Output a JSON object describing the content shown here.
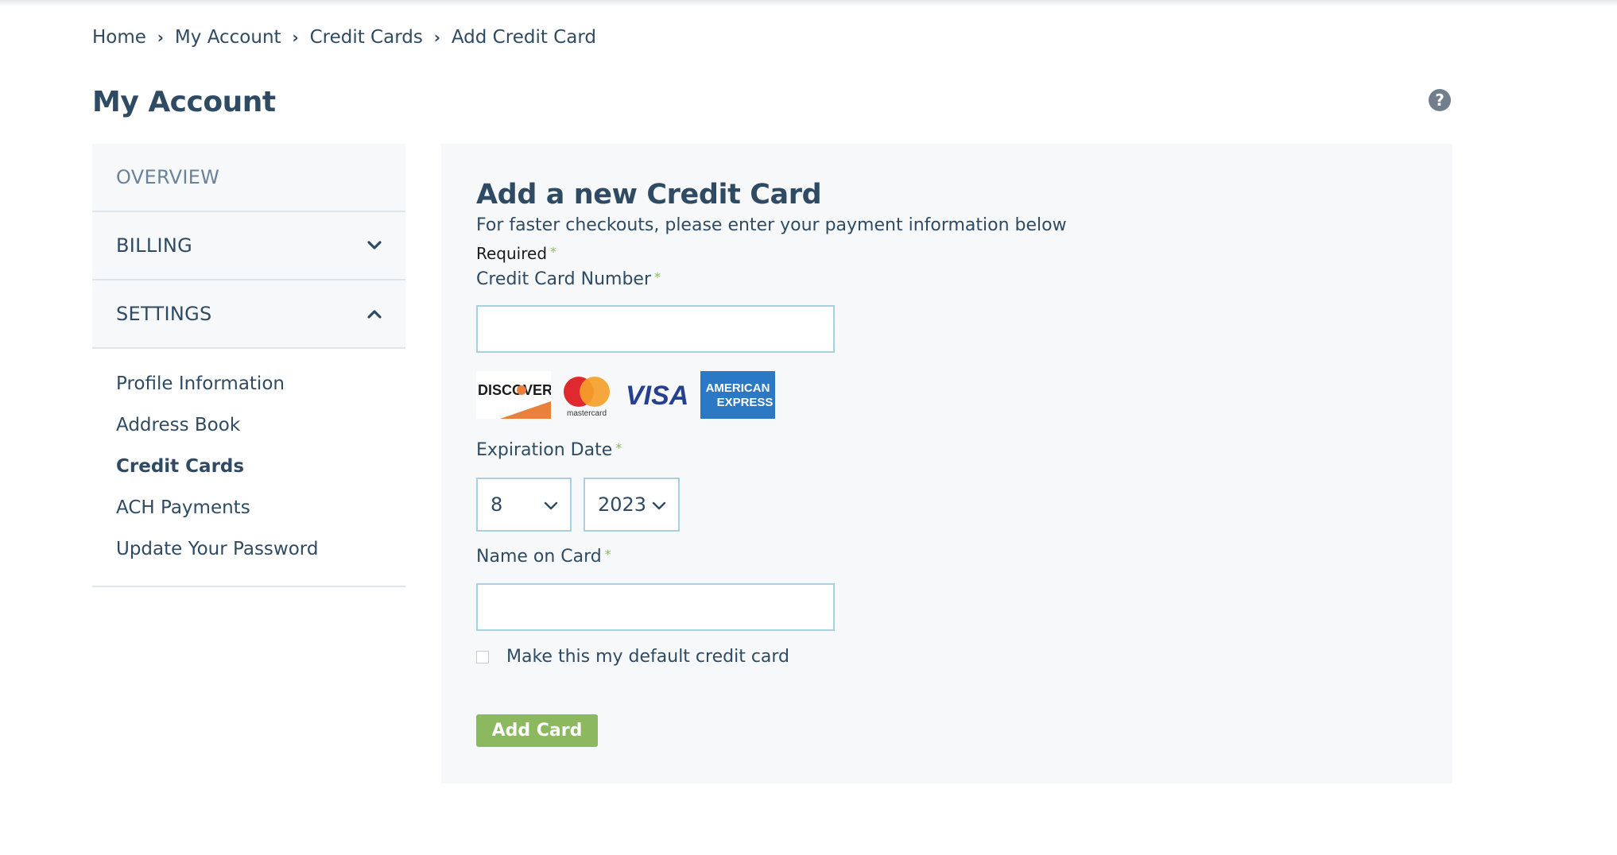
{
  "breadcrumb": {
    "items": [
      "Home",
      "My Account",
      "Credit Cards",
      "Add Credit Card"
    ],
    "separator": "›"
  },
  "page": {
    "title": "My Account",
    "help_icon": "?"
  },
  "sidebar": {
    "sections": [
      {
        "label": "OVERVIEW",
        "icon": null
      },
      {
        "label": "BILLING",
        "icon": "chevron-down-icon"
      },
      {
        "label": "SETTINGS",
        "icon": "chevron-up-icon"
      }
    ],
    "settings_items": [
      {
        "label": "Profile Information",
        "active": false
      },
      {
        "label": "Address Book",
        "active": false
      },
      {
        "label": "Credit Cards",
        "active": true
      },
      {
        "label": "ACH Payments",
        "active": false
      },
      {
        "label": "Update Your Password",
        "active": false
      }
    ]
  },
  "form": {
    "title": "Add a new Credit Card",
    "subtitle": "For faster checkouts, please enter your payment information below",
    "required_note": "Required",
    "required_marker": "*",
    "card_number": {
      "label": "Credit Card Number",
      "value": "",
      "placeholder": ""
    },
    "card_logos": [
      "Discover",
      "Mastercard",
      "Visa",
      "American Express"
    ],
    "card_logo_text": {
      "discover": "DISCOVER",
      "mastercard": "mastercard",
      "visa": "VISA",
      "amex_line1": "AMERICAN",
      "amex_line2": "EXPRESS"
    },
    "expiration": {
      "label": "Expiration Date",
      "month": "8",
      "year": "2023"
    },
    "name_on_card": {
      "label": "Name on Card",
      "value": "",
      "placeholder": ""
    },
    "default_checkbox": {
      "label": "Make this my default credit card",
      "checked": false
    },
    "submit_label": "Add Card"
  },
  "colors": {
    "primary_text": "#2f4a63",
    "accent_green": "#8cb85f",
    "panel_bg": "#f6f8f9",
    "input_border": "#a9cfe2"
  }
}
